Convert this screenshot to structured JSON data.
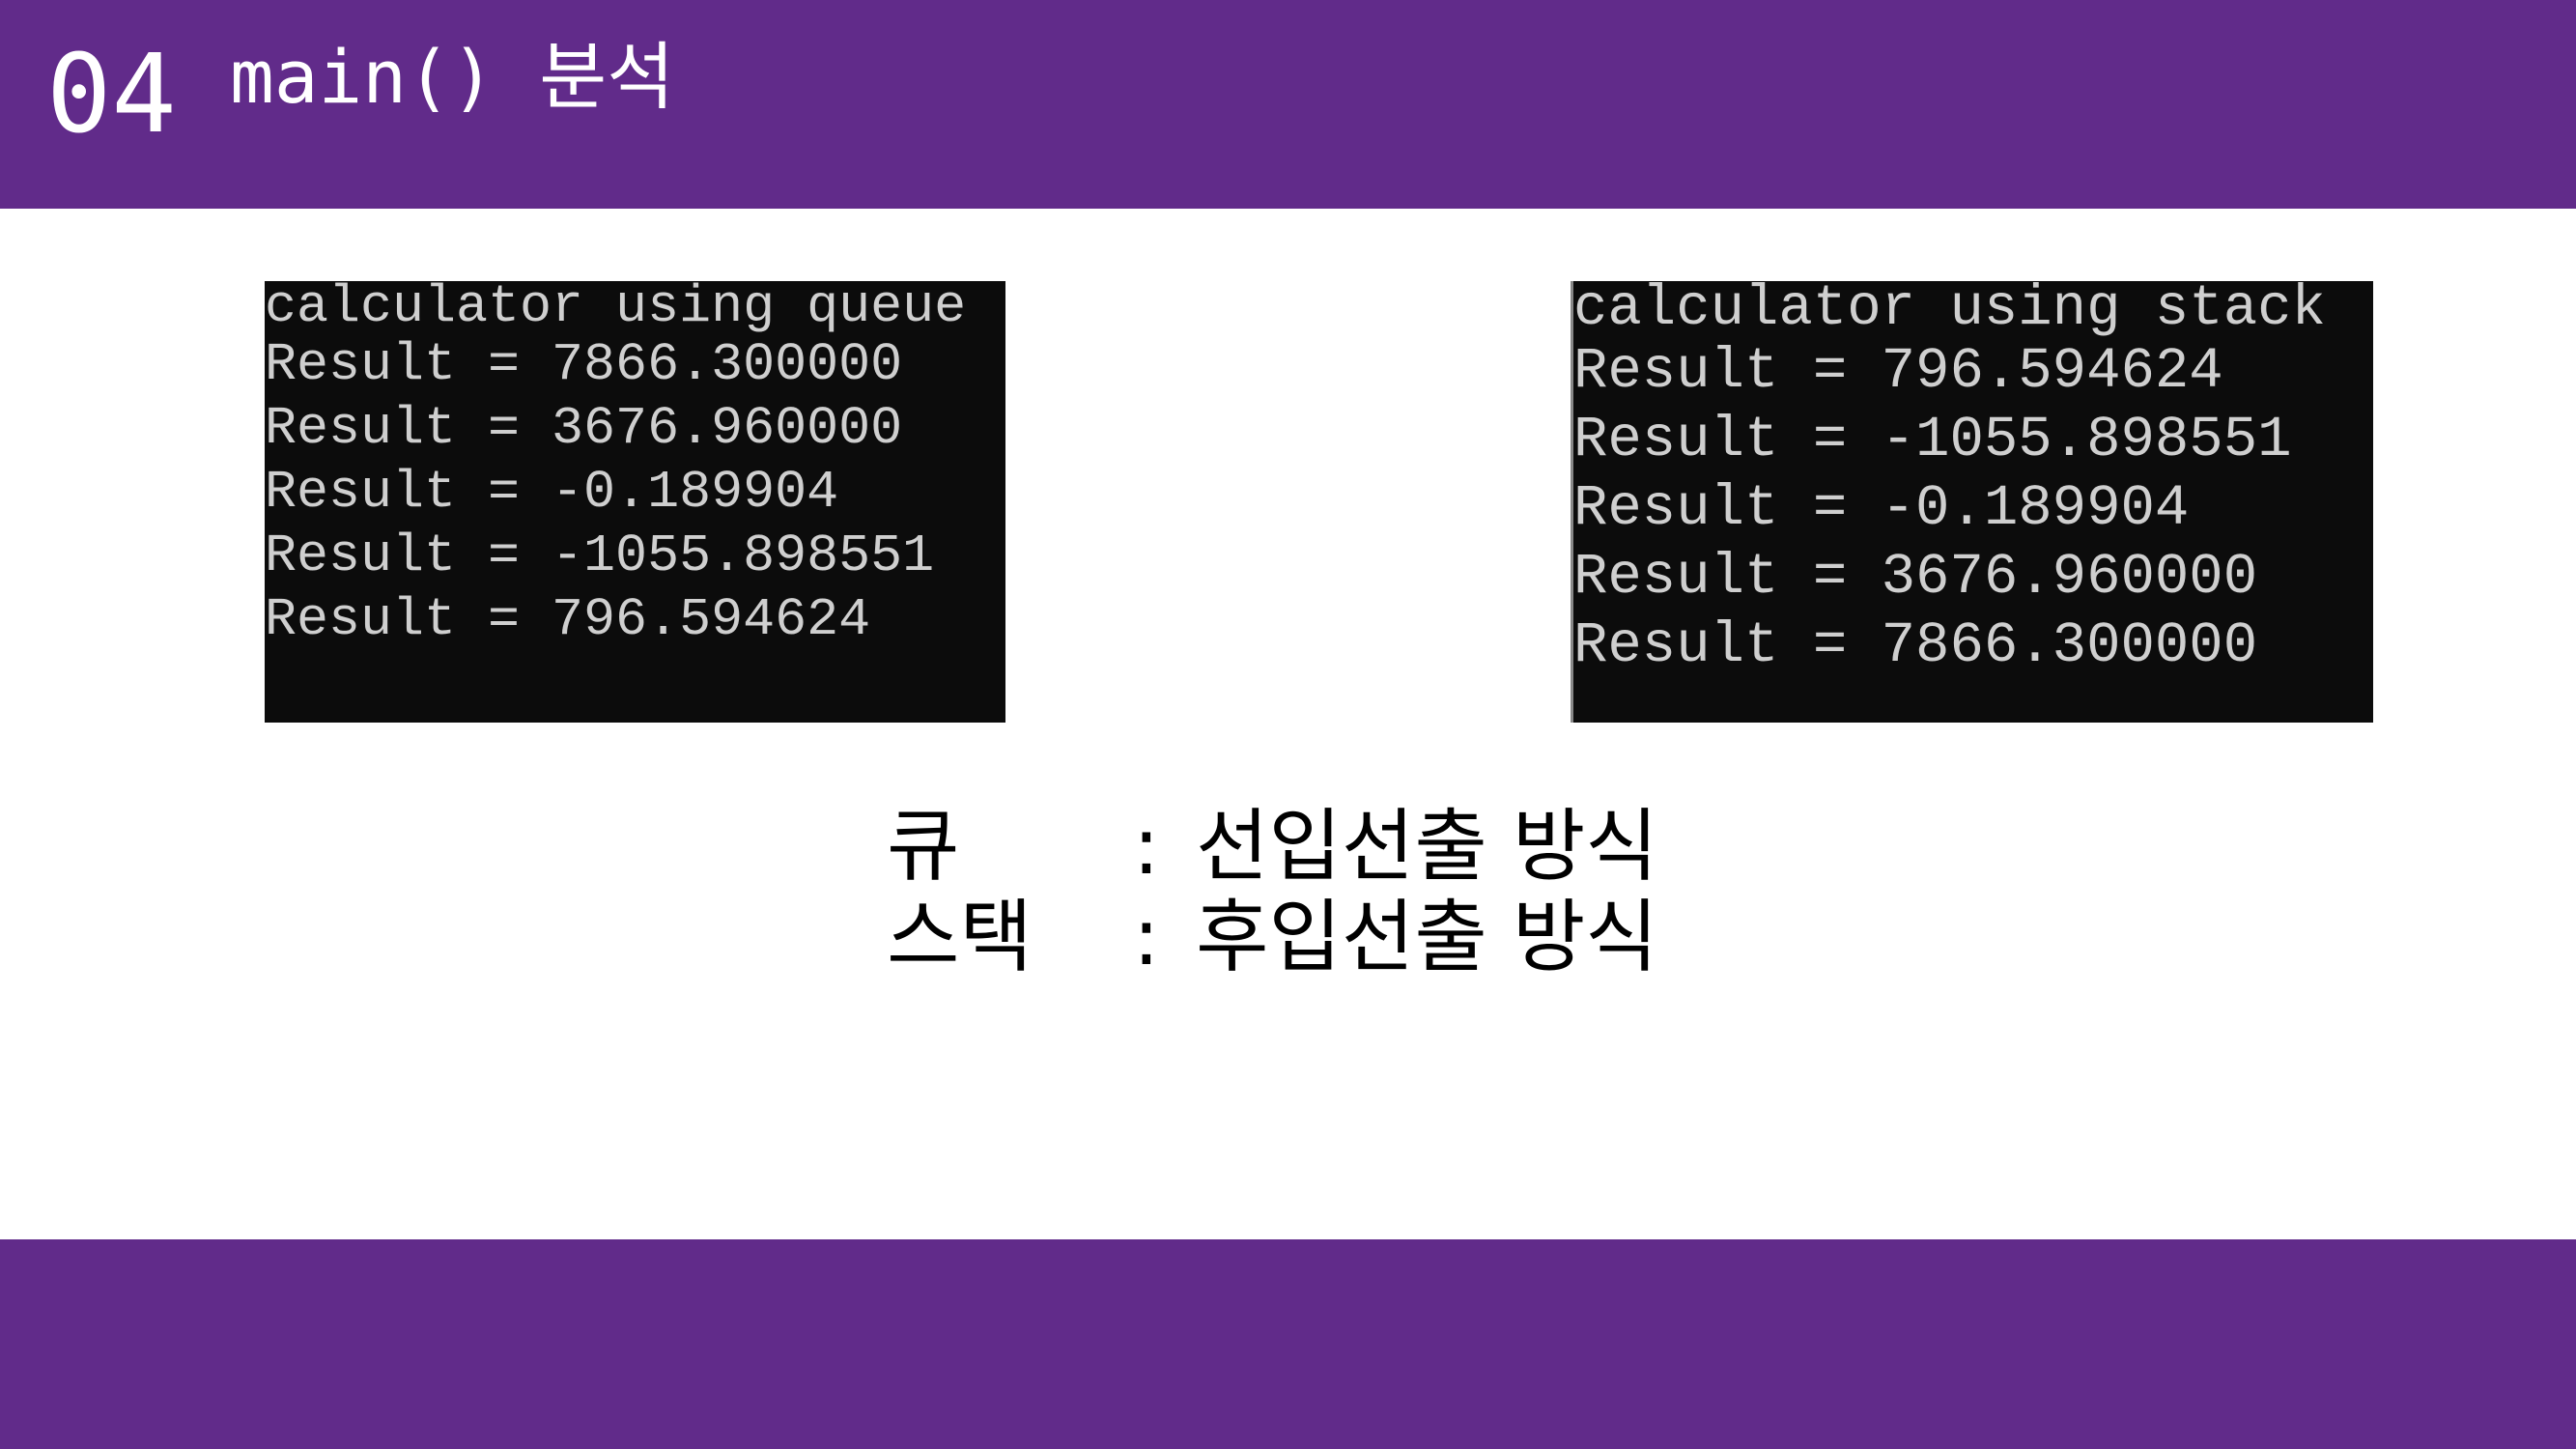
{
  "header": {
    "number": "04",
    "title": "main() 분석"
  },
  "queue_terminal": {
    "lines": [
      "calculator using queue",
      "Result = 7866.300000",
      "Result = 3676.960000",
      "Result = -0.189904",
      "Result = -1055.898551",
      "Result = 796.594624"
    ]
  },
  "stack_terminal": {
    "lines": [
      "calculator using stack",
      "Result = 796.594624",
      "Result = -1055.898551",
      "Result = -0.189904",
      "Result = 3676.960000",
      "Result = 7866.300000"
    ]
  },
  "description": [
    {
      "term": "큐",
      "colon": ":",
      "text": "선입선출 방식"
    },
    {
      "term": "스택",
      "colon": ":",
      "text": "후입선출 방식"
    }
  ],
  "colors": {
    "brand": "#612b8a",
    "terminal_bg": "#0c0c0c",
    "terminal_fg": "#cfcfcf"
  }
}
